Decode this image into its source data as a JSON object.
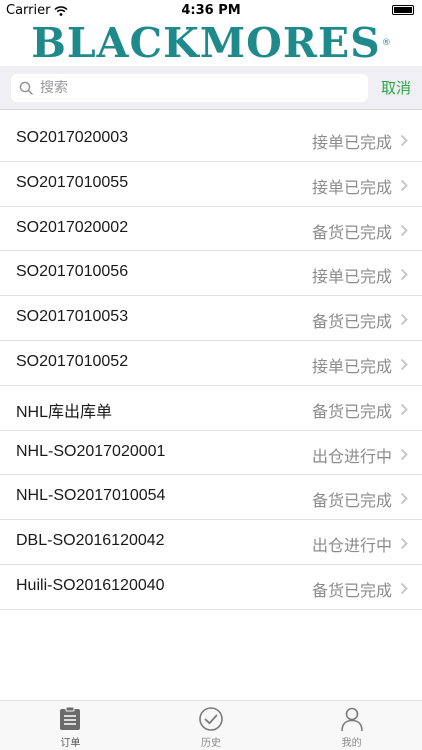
{
  "status_bar": {
    "carrier": "Carrier",
    "time": "4:36 PM"
  },
  "brand": {
    "logo_text": "BLACKMORES",
    "reg_mark": "®",
    "color": "#1f8a8c"
  },
  "search": {
    "placeholder": "搜索",
    "value": "",
    "cancel_label": "取消",
    "cancel_color": "#29a843"
  },
  "orders": [
    {
      "id": "SO2017020003",
      "status": "接单已完成"
    },
    {
      "id": "SO2017010055",
      "status": "接单已完成"
    },
    {
      "id": "SO2017020002",
      "status": "备货已完成"
    },
    {
      "id": "SO2017010056",
      "status": "接单已完成"
    },
    {
      "id": "SO2017010053",
      "status": "备货已完成"
    },
    {
      "id": "SO2017010052",
      "status": "接单已完成"
    },
    {
      "id": "NHL库出库单",
      "status": "备货已完成"
    },
    {
      "id": "NHL-SO2017020001",
      "status": "出仓进行中"
    },
    {
      "id": "NHL-SO2017010054",
      "status": "备货已完成"
    },
    {
      "id": "DBL-SO2016120042",
      "status": "出仓进行中"
    },
    {
      "id": "Huili-SO2016120040",
      "status": "备货已完成"
    }
  ],
  "tabs": [
    {
      "label": "订单",
      "icon": "clipboard-icon"
    },
    {
      "label": "历史",
      "icon": "check-circle-icon"
    },
    {
      "label": "我的",
      "icon": "person-icon"
    }
  ]
}
